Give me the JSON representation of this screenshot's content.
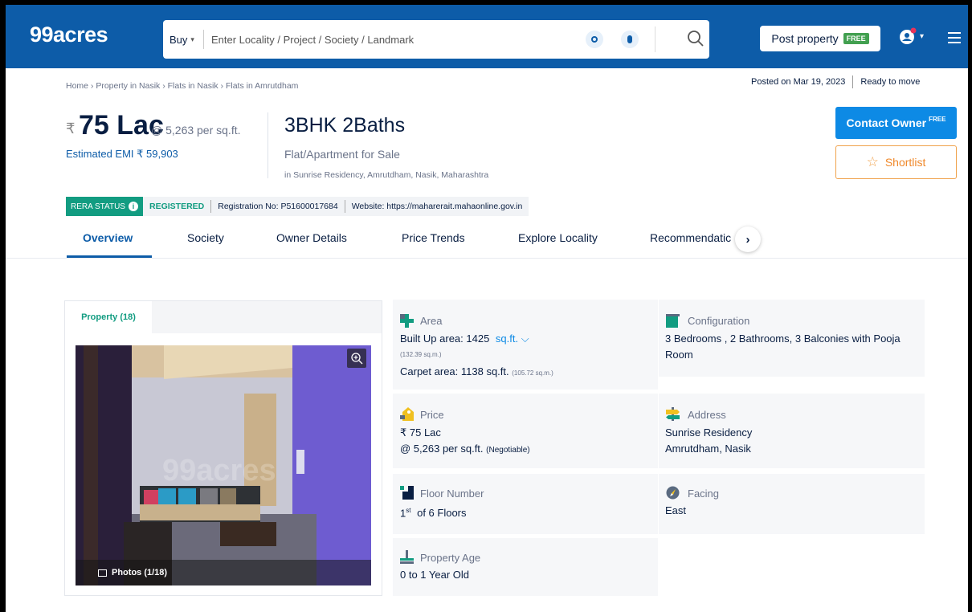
{
  "header": {
    "logo": "99acres",
    "buy_label": "Buy",
    "search_placeholder": "Enter Locality / Project / Society / Landmark",
    "post_property": "Post property",
    "free": "FREE"
  },
  "breadcrumb": "Home › Property in Nasik › Flats in Nasik › Flats in Amrutdham",
  "posted_on": "Posted on Mar 19, 2023",
  "ready_status": "Ready to move",
  "price": {
    "currency": "₹",
    "amount": "75 Lac",
    "rate": "@ 5,263 per sq.ft.",
    "emi": "Estimated EMI ₹ 59,903"
  },
  "listing": {
    "title": "3BHK 2Baths",
    "subtitle": "Flat/Apartment for Sale",
    "location": "in Sunrise Residency, Amrutdham, Nasik, Maharashtra"
  },
  "actions": {
    "contact": "Contact Owner",
    "contact_badge": "FREE",
    "shortlist": "Shortlist"
  },
  "rera": {
    "badge": "RERA STATUS",
    "status": "REGISTERED",
    "registration": "Registration No: P51600017684",
    "website": "Website: https://maharerait.mahaonline.gov.in"
  },
  "tabs": [
    "Overview",
    "Society",
    "Owner Details",
    "Price Trends",
    "Explore Locality",
    "Recommendatic"
  ],
  "gallery": {
    "tab": "Property (18)",
    "photos": "Photos (1/18)",
    "watermark": "99acres"
  },
  "details": {
    "area": {
      "label": "Area",
      "built_up": "Built Up area: 1425",
      "unit": "sq.ft.",
      "built_up_sqm": "(132.39 sq.m.)",
      "carpet": "Carpet area: 1138 sq.ft.",
      "carpet_sqm": "(105.72 sq.m.)"
    },
    "configuration": {
      "label": "Configuration",
      "value": "3 Bedrooms , 2 Bathrooms, 3 Balconies with Pooja Room"
    },
    "price": {
      "label": "Price",
      "value": "₹ 75 Lac",
      "rate": "@ 5,263 per sq.ft.",
      "negotiable": "(Negotiable)"
    },
    "address": {
      "label": "Address",
      "line1": "Sunrise Residency",
      "line2": "Amrutdham, Nasik"
    },
    "floor": {
      "label": "Floor Number",
      "num": "1",
      "sup": "st",
      "of": "of 6 Floors"
    },
    "facing": {
      "label": "Facing",
      "value": "East"
    },
    "age": {
      "label": "Property Age",
      "value": "0 to 1 Year Old"
    }
  },
  "colors": {
    "brand_blue": "#0d5ca8",
    "contact_blue": "#0d8ae5",
    "rera_green": "#129c81",
    "shortlist_orange": "#f0a24b"
  }
}
